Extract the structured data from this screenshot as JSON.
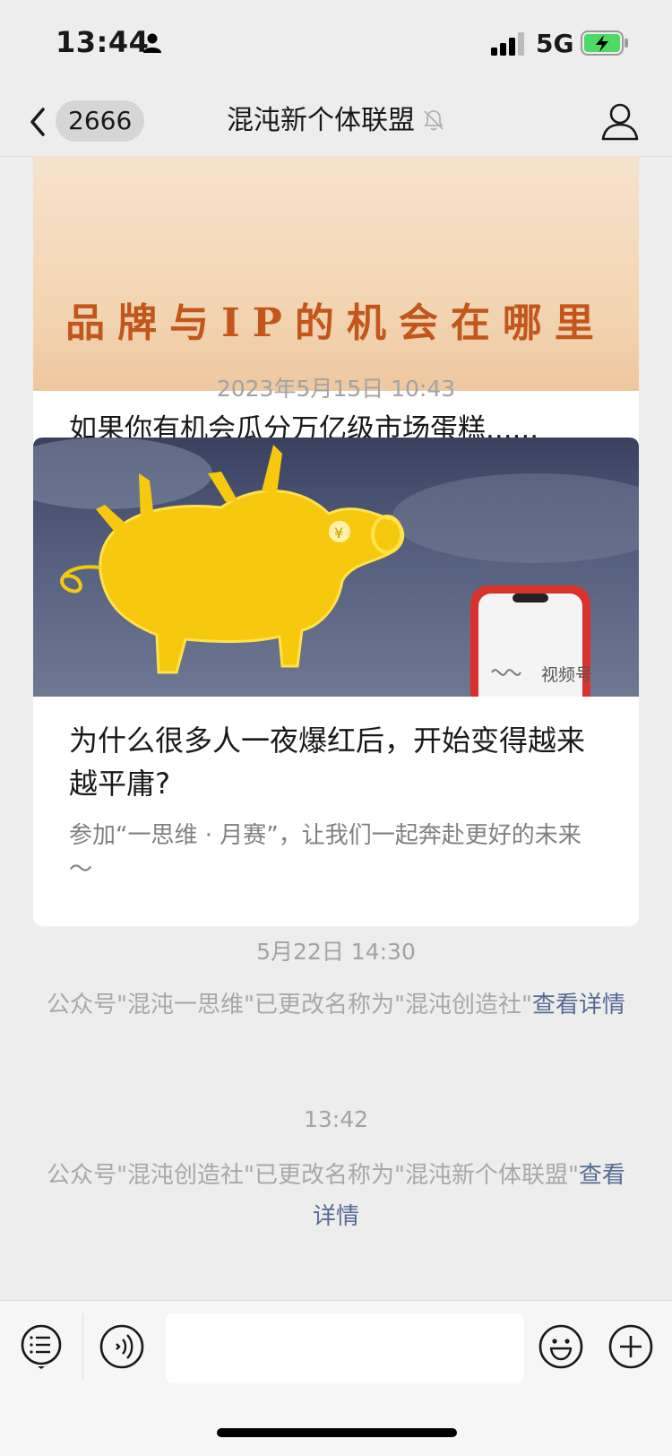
{
  "status_bar": {
    "time": "13:44",
    "network": "5G"
  },
  "nav": {
    "back_count": "2666",
    "title": "混沌新个体联盟"
  },
  "messages": {
    "article1": {
      "banner_text": "品牌与IP的机会在哪里",
      "title": "如果你有机会瓜分万亿级市场蛋糕......"
    },
    "time1": "2023年5月15日 10:43",
    "article2": {
      "cover_label": "视频号",
      "title": "为什么很多人一夜爆红后，开始变得越来越平庸?",
      "desc": "参加“一思维 · 月赛”，让我们一起奔赴更好的未来～"
    },
    "time2": "5月22日 14:30",
    "notice1": {
      "text": "公众号\"混沌一思维\"已更改名称为\"混沌创造社\"",
      "link": "查看详情"
    },
    "time3": "13:42",
    "notice2": {
      "text": "公众号\"混沌创造社\"已更改名称为\"混沌新个体联盟\"",
      "link": "查看详情"
    }
  },
  "colors": {
    "background": "#ededed",
    "link": "#576b95",
    "battery": "#4cd964"
  },
  "icons": [
    "person-icon",
    "signal-icon",
    "battery-icon",
    "back-icon",
    "mute-icon",
    "profile-icon",
    "menu-icon",
    "voice-icon",
    "emoji-icon",
    "add-icon"
  ]
}
